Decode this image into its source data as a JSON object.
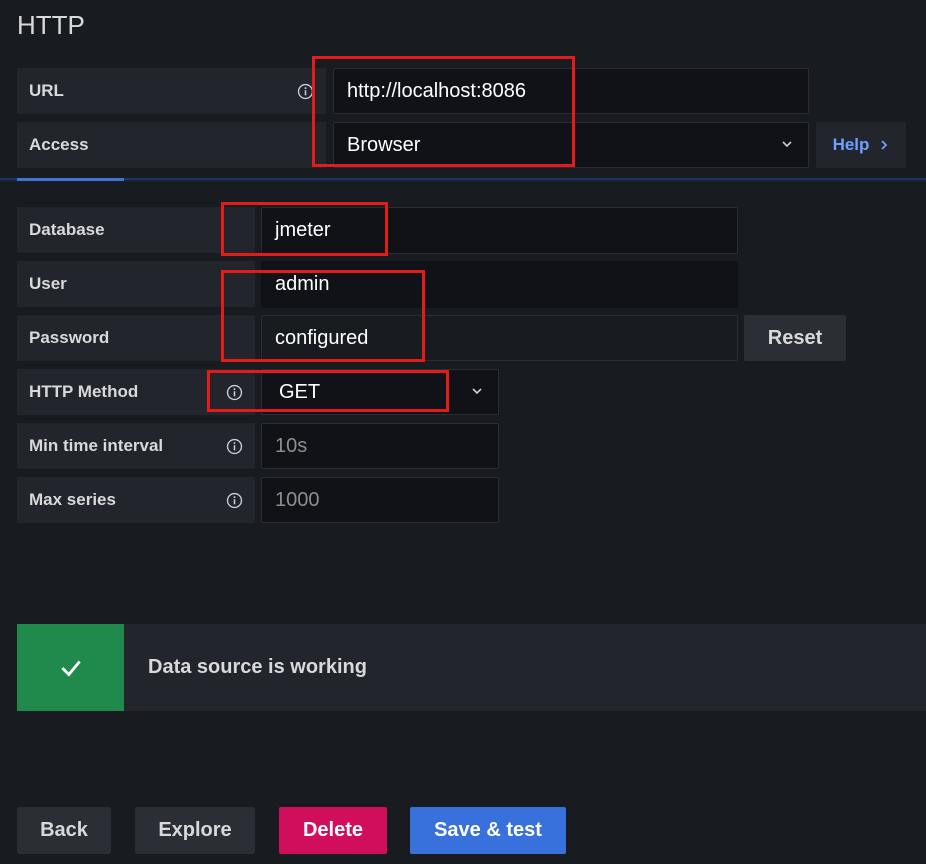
{
  "section_title": "HTTP",
  "http": {
    "url_label": "URL",
    "url_value": "http://localhost:8086",
    "access_label": "Access",
    "access_value": "Browser",
    "help_label": "Help"
  },
  "db": {
    "database_label": "Database",
    "database_value": "jmeter",
    "user_label": "User",
    "user_value": "admin",
    "password_label": "Password",
    "password_value": "configured",
    "reset_label": "Reset",
    "method_label": "HTTP Method",
    "method_value": "GET",
    "min_interval_label": "Min time interval",
    "min_interval_placeholder": "10s",
    "max_series_label": "Max series",
    "max_series_placeholder": "1000"
  },
  "alert": {
    "message": "Data source is working",
    "color": "#1f8a4c"
  },
  "actions": {
    "back": "Back",
    "explore": "Explore",
    "delete": "Delete",
    "save_test": "Save & test"
  },
  "colors": {
    "highlight": "#e31b1b",
    "primary": "#3871dc",
    "destructive": "#d10e5c",
    "link": "#6e9fff"
  }
}
